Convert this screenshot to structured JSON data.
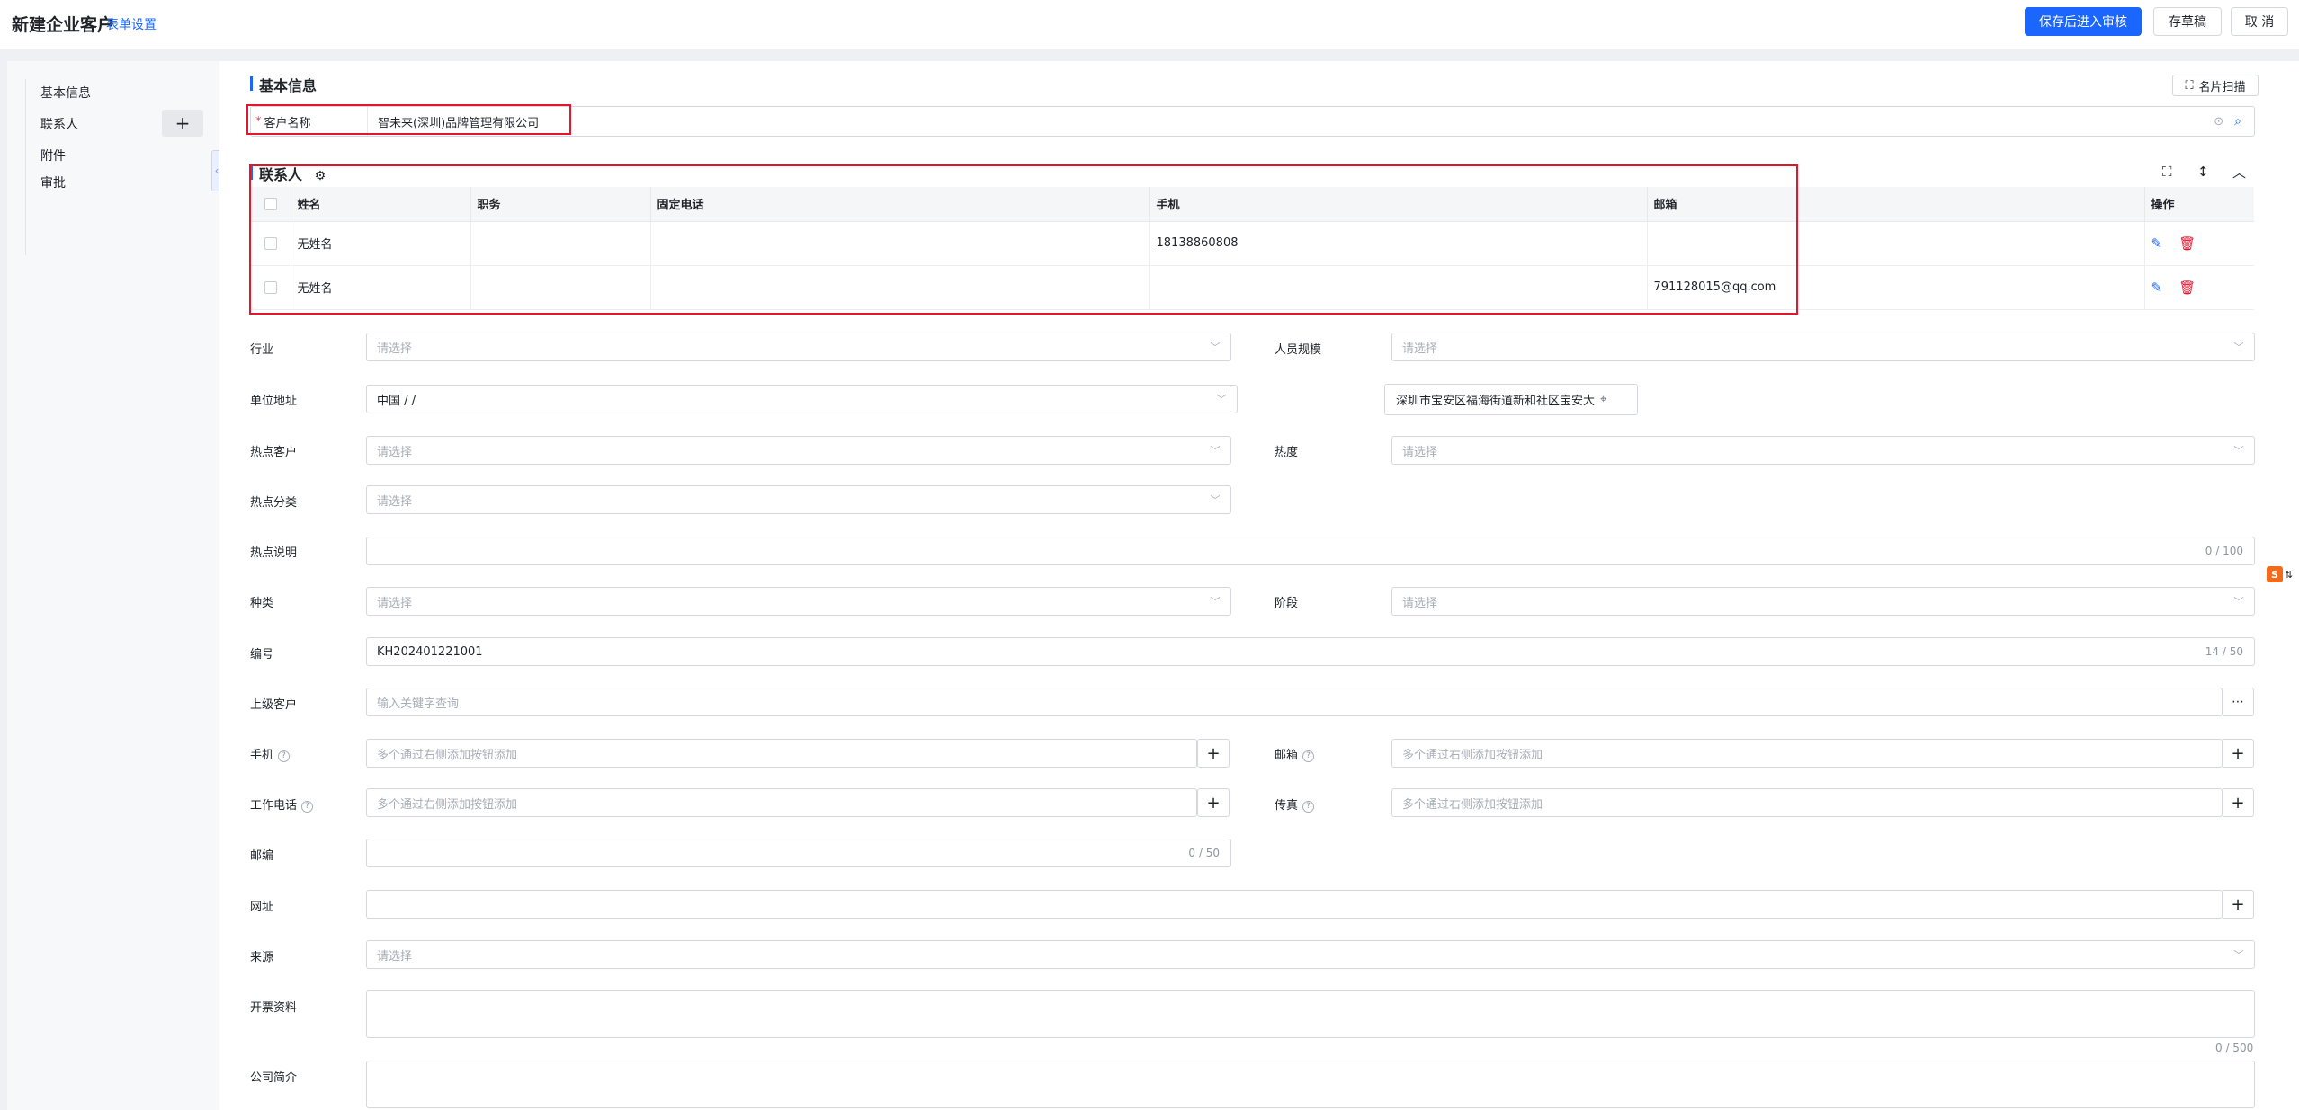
{
  "header": {
    "title": "新建企业客户",
    "form_settings": "表单设置",
    "save_submit": "保存后进入审核",
    "save_draft": "存草稿",
    "cancel": "取 消"
  },
  "sidebar": {
    "items": [
      {
        "label": "基本信息"
      },
      {
        "label": "联系人"
      },
      {
        "label": "附件"
      },
      {
        "label": "审批"
      }
    ],
    "add_symbol": "+",
    "collapse_symbol": "‹"
  },
  "basic_info": {
    "title": "基本信息",
    "scan_card": "名片扫描",
    "customer_name_label": "客户名称",
    "customer_name_value": "智未来(深圳)品牌管理有限公司"
  },
  "contacts": {
    "title": "联系人",
    "columns": [
      "姓名",
      "职务",
      "固定电话",
      "手机",
      "邮箱",
      "操作"
    ],
    "rows": [
      {
        "name": "无姓名",
        "title": "",
        "phone": "",
        "mobile": "18138860808",
        "email": ""
      },
      {
        "name": "无姓名",
        "title": "",
        "phone": "",
        "mobile": "",
        "email": "791128015@qq.com"
      }
    ]
  },
  "form": {
    "select_placeholder": "请选择",
    "multi_placeholder": "多个通过右侧添加按钮添加",
    "keyword_placeholder": "输入关键字查询",
    "industry_label": "行业",
    "staff_scale_label": "人员规模",
    "address_label": "单位地址",
    "address_region": "中国 / /",
    "address_detail": "深圳市宝安区福海街道新和社区宝安大",
    "hot_customer_label": "热点客户",
    "heat_label": "热度",
    "hot_category_label": "热点分类",
    "hot_desc_label": "热点说明",
    "hot_desc_count": "0 / 100",
    "kind_label": "种类",
    "stage_label": "阶段",
    "code_label": "编号",
    "code_value": "KH202401221001",
    "code_count": "14 / 50",
    "parent_customer_label": "上级客户",
    "mobile_label": "手机",
    "email_label": "邮箱",
    "work_phone_label": "工作电话",
    "fax_label": "传真",
    "postcode_label": "邮编",
    "postcode_count": "0 / 50",
    "website_label": "网址",
    "source_label": "来源",
    "invoice_label": "开票资料",
    "invoice_count": "0 / 500",
    "intro_label": "公司简介"
  },
  "colors": {
    "primary": "#1a66ff",
    "danger": "#e5152d",
    "highlight_box": "#e5152d"
  }
}
